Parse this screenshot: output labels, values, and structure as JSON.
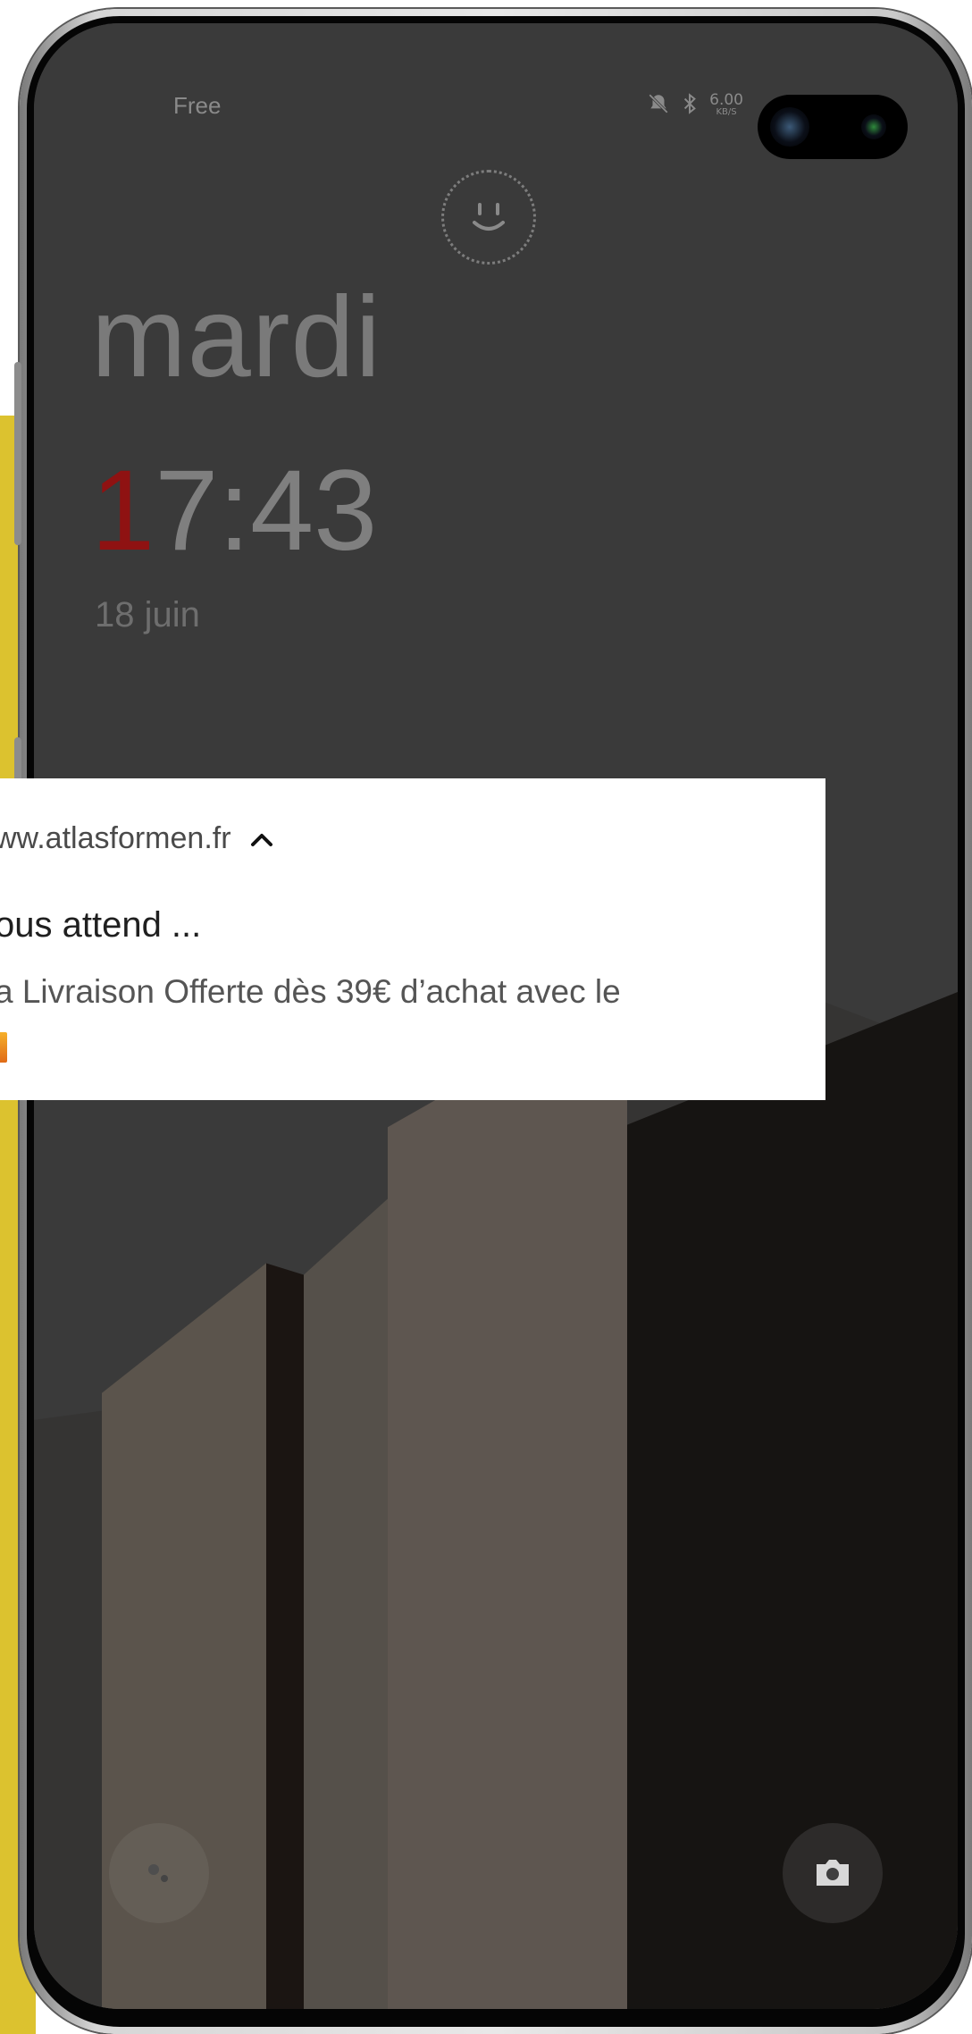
{
  "status_bar": {
    "carrier": "Free",
    "network_speed_value": "6.00",
    "network_speed_unit": "KB/S",
    "icons": [
      "mute-icon",
      "bluetooth-icon"
    ]
  },
  "lockscreen": {
    "day": "mardi",
    "time_first_digit": "1",
    "time_rest": "7:43",
    "date": "18 juin"
  },
  "notification": {
    "app": "ww.atlasformen.fr",
    "title": "ous attend ...",
    "body": "a Livraison Offerte dès 39€ d’achat avec le"
  },
  "shortcuts": {
    "left_icon": "assistant-icon",
    "right_icon": "camera-icon"
  },
  "colors": {
    "screen_bg": "#3a3a3a",
    "accent_red": "#8f1212",
    "background_yellow": "#dcc22f"
  }
}
